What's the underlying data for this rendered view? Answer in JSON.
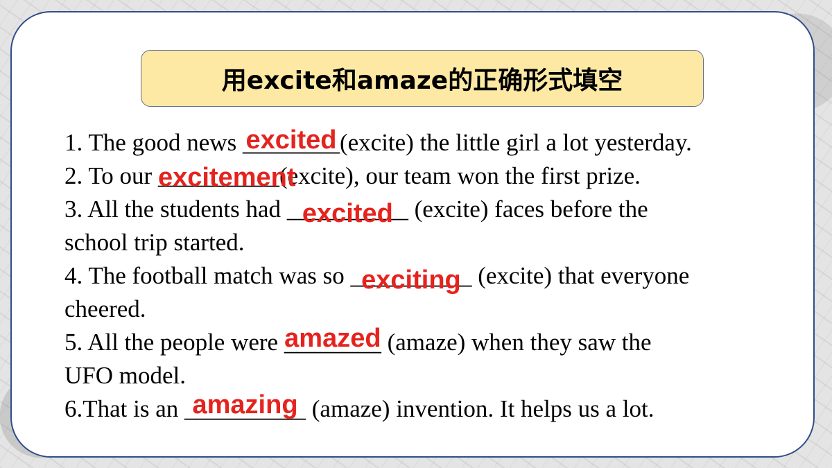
{
  "title": "用excite和amaze的正确形式填空",
  "questions": [
    {
      "before": "1. The good news ",
      "blank": "________",
      "answer": "excited",
      "after": "(excite) the little girl a lot yesterday."
    },
    {
      "before": "2. To our ",
      "blank": "__________",
      "answer": "excitement",
      "after": "(excite), our team won the first prize."
    },
    {
      "before": "3. All the students had ",
      "blank": "__________",
      "answer": "excited",
      "after": " (excite) faces before the",
      "after2": "school trip started."
    },
    {
      "before": "4. The football match was so ",
      "blank": "__________",
      "answer": "exciting",
      "after": " (excite) that everyone",
      "after2": "cheered."
    },
    {
      "before": "5. All the people were ",
      "blank": "________",
      "answer": "amazed",
      "after": " (amaze) when they saw the",
      "after2": "UFO model."
    },
    {
      "before": "6.That is an ",
      "blank": "__________",
      "answer": "amazing",
      "after": " (amaze) invention. It helps us a lot."
    }
  ],
  "colors": {
    "answer": "#e5231e",
    "title_bg": "#fde9a4",
    "card_border": "#2f4d8a"
  }
}
